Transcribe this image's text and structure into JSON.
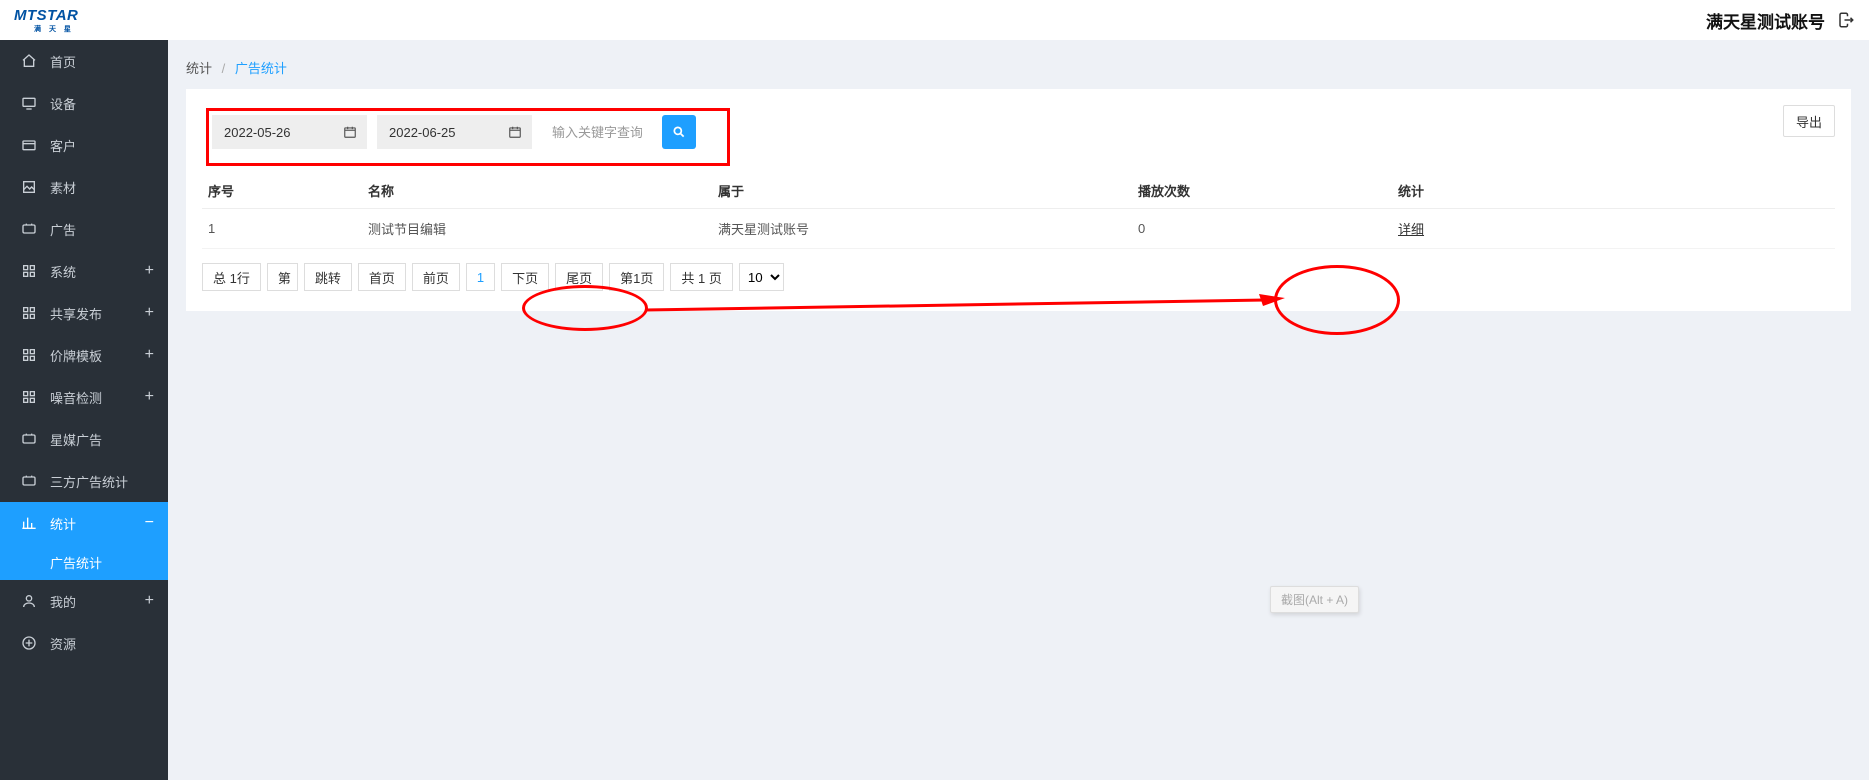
{
  "header": {
    "logo_main": "MTSTAR",
    "logo_sub": "满 天 星",
    "account": "满天星测试账号"
  },
  "sidebar": {
    "items": [
      {
        "label": "首页",
        "icon": "home-icon",
        "expandable": false
      },
      {
        "label": "设备",
        "icon": "device-icon",
        "expandable": false
      },
      {
        "label": "客户",
        "icon": "customer-icon",
        "expandable": false
      },
      {
        "label": "素材",
        "icon": "material-icon",
        "expandable": false
      },
      {
        "label": "广吿",
        "icon": "ad-icon",
        "expandable": false
      },
      {
        "label": "系统",
        "icon": "system-icon",
        "expandable": true
      },
      {
        "label": "共享发布",
        "icon": "share-icon",
        "expandable": true
      },
      {
        "label": "价牌模板",
        "icon": "template-icon",
        "expandable": true
      },
      {
        "label": "噪音检测",
        "icon": "noise-icon",
        "expandable": true
      },
      {
        "label": "星媒广告",
        "icon": "media-ad-icon",
        "expandable": false
      },
      {
        "label": "三方广告统计",
        "icon": "third-ad-icon",
        "expandable": false
      },
      {
        "label": "统计",
        "icon": "stats-icon",
        "expandable": true,
        "active": true,
        "open": true,
        "children": [
          {
            "label": "广告统计"
          }
        ]
      },
      {
        "label": "我的",
        "icon": "profile-icon",
        "expandable": true
      },
      {
        "label": "资源",
        "icon": "resource-icon",
        "expandable": false
      }
    ]
  },
  "breadcrumb": {
    "root": "统计",
    "current": "广告统计"
  },
  "filters": {
    "date_from": "2022-05-26",
    "date_to": "2022-06-25",
    "keyword_placeholder": "输入关键字查询"
  },
  "actions": {
    "export_label": "导出"
  },
  "table": {
    "columns": [
      "序号",
      "名称",
      "属于",
      "播放次数",
      "统计"
    ],
    "rows": [
      {
        "index": "1",
        "name": "测试节目编辑",
        "owner": "满天星测试账号",
        "plays": "0",
        "detail": "详细"
      }
    ]
  },
  "pagination": {
    "total_label": "总 1行",
    "goto_prefix": "第",
    "jump_label": "跳转",
    "first_label": "首页",
    "prev_label": "前页",
    "current_page": "1",
    "next_label": "下页",
    "last_label": "尾页",
    "page_info": "第1页",
    "pages_total": "共 1 页",
    "page_size_options": [
      "10"
    ],
    "page_size_selected": "10"
  },
  "hint": {
    "text": "截图(Alt + A)"
  }
}
